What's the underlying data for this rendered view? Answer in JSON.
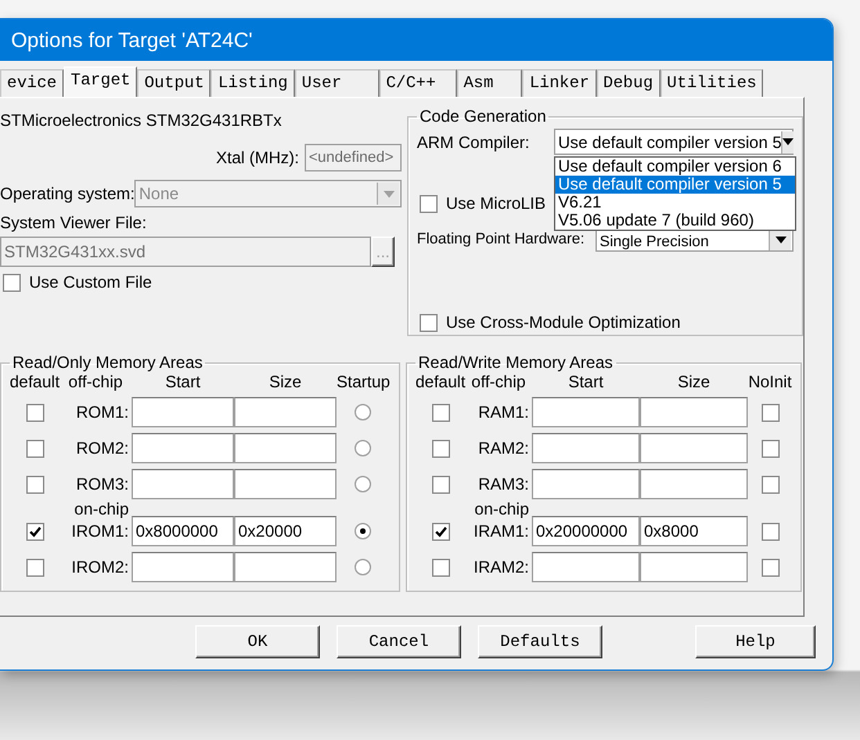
{
  "window": {
    "title": "Options for Target 'AT24C'"
  },
  "tabs": [
    {
      "label": "evice",
      "selected": false
    },
    {
      "label": "Target",
      "selected": true
    },
    {
      "label": "Output",
      "selected": false
    },
    {
      "label": "Listing",
      "selected": false
    },
    {
      "label": "User",
      "selected": false
    },
    {
      "label": "C/C++",
      "selected": false
    },
    {
      "label": "Asm",
      "selected": false
    },
    {
      "label": "Linker",
      "selected": false
    },
    {
      "label": "Debug",
      "selected": false
    },
    {
      "label": "Utilities",
      "selected": false
    }
  ],
  "device": "STMicroelectronics STM32G431RBTx",
  "xtal": {
    "label": "Xtal (MHz):",
    "value": "<undefined>",
    "disabled": true
  },
  "operating_system": {
    "label": "Operating system:",
    "value": "None",
    "disabled": true
  },
  "system_viewer_file": {
    "label": "System Viewer File:",
    "value": "STM32G431xx.svd",
    "browse": "...",
    "disabled": true
  },
  "use_custom_file": {
    "label": "Use Custom File",
    "checked": false
  },
  "code_generation": {
    "title": "Code Generation",
    "arm_compiler": {
      "label": "ARM Compiler:",
      "value": "Use default compiler version 5",
      "expanded": true,
      "options": [
        {
          "label": "Use default compiler version 6",
          "selected": false
        },
        {
          "label": "Use default compiler version 5",
          "selected": true
        },
        {
          "label": "V6.21",
          "selected": false
        },
        {
          "label": "V5.06 update 7 (build 960)",
          "selected": false
        }
      ]
    },
    "use_microlib": {
      "label": "Use MicroLIB",
      "checked": false
    },
    "floating_point": {
      "label": "Floating Point Hardware:",
      "value": "Single Precision"
    },
    "cross_module": {
      "label": "Use Cross-Module Optimization",
      "checked": false
    }
  },
  "rom": {
    "title": "Read/Only Memory Areas",
    "headers": [
      "default",
      "off-chip",
      "Start",
      "Size",
      "Startup"
    ],
    "rows": [
      {
        "kind": "area",
        "label": "ROM1:",
        "default": false,
        "start": "",
        "size": "",
        "selected": false
      },
      {
        "kind": "area",
        "label": "ROM2:",
        "default": false,
        "start": "",
        "size": "",
        "selected": false
      },
      {
        "kind": "area",
        "label": "ROM3:",
        "default": false,
        "start": "",
        "size": "",
        "selected": false
      },
      {
        "kind": "section",
        "label": "on-chip"
      },
      {
        "kind": "area",
        "label": "IROM1:",
        "default": true,
        "start": "0x8000000",
        "size": "0x20000",
        "selected": true
      },
      {
        "kind": "area",
        "label": "IROM2:",
        "default": false,
        "start": "",
        "size": "",
        "selected": false
      }
    ]
  },
  "ram": {
    "title": "Read/Write Memory Areas",
    "headers": [
      "default",
      "off-chip",
      "Start",
      "Size",
      "NoInit"
    ],
    "rows": [
      {
        "kind": "area",
        "label": "RAM1:",
        "default": false,
        "start": "",
        "size": "",
        "checked": false
      },
      {
        "kind": "area",
        "label": "RAM2:",
        "default": false,
        "start": "",
        "size": "",
        "checked": false
      },
      {
        "kind": "area",
        "label": "RAM3:",
        "default": false,
        "start": "",
        "size": "",
        "checked": false
      },
      {
        "kind": "section",
        "label": "on-chip"
      },
      {
        "kind": "area",
        "label": "IRAM1:",
        "default": true,
        "start": "0x20000000",
        "size": "0x8000",
        "checked": false
      },
      {
        "kind": "area",
        "label": "IRAM2:",
        "default": false,
        "start": "",
        "size": "",
        "checked": false
      }
    ]
  },
  "buttons": [
    {
      "label": "OK",
      "kind": "main"
    },
    {
      "label": "Cancel",
      "kind": "main"
    },
    {
      "label": "Defaults",
      "kind": "main"
    },
    {
      "label": "Help",
      "kind": "help"
    }
  ]
}
